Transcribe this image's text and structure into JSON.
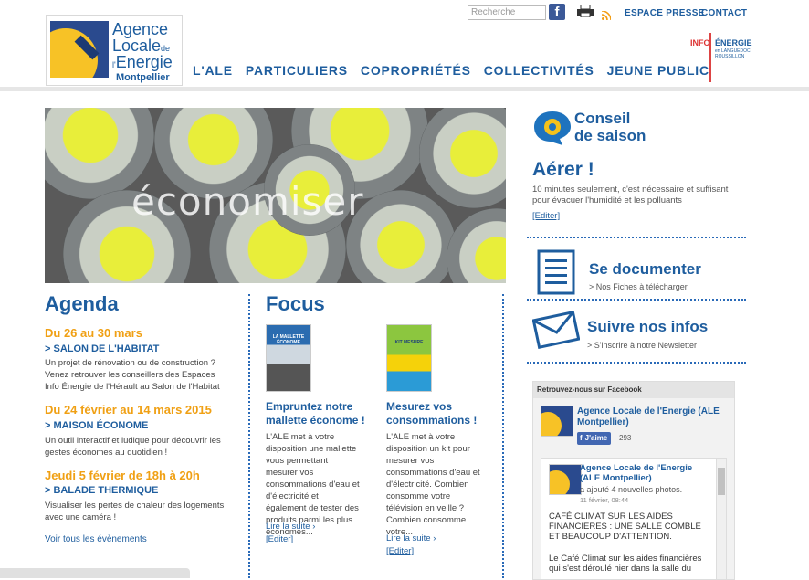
{
  "header": {
    "logo": {
      "line1": "Agence",
      "line2": "Locale",
      "line2_small": "de",
      "line3": "Energie",
      "line3_small": "l'",
      "line4": "Montpellier"
    },
    "search": {
      "placeholder": "Recherche"
    },
    "links": {
      "espace_presse": "ESPACE PRESSE",
      "contact": "CONTACT"
    },
    "partner": {
      "left": "INFO",
      "right": "ÉNERGIE",
      "sub": "en LANGUEDOC ROUSSILLON"
    },
    "nav": [
      "L'ALE",
      "PARTICULIERS",
      "COPROPRIÉTÉS",
      "COLLECTIVITÉS",
      "JEUNE PUBLIC"
    ]
  },
  "hero": {
    "word": "économiser"
  },
  "agenda": {
    "title": "Agenda",
    "events": [
      {
        "date": "Du 26 au 30 mars",
        "name": "> SALON DE L'HABITAT",
        "desc": "Un projet de rénovation ou de construction ? Venez retrouver les conseillers des Espaces Info Énergie de l'Hérault au Salon de l'Habitat"
      },
      {
        "date": "Du 24 février au 14 mars 2015",
        "name": "> MAISON ÉCONOME",
        "desc": "Un outil interactif et ludique pour découvrir les gestes économes au quotidien !"
      },
      {
        "date": "Jeudi 5 février de 18h à 20h",
        "name": "> BALADE THERMIQUE",
        "desc": "Visualiser les pertes de chaleur des logements avec une caméra !"
      }
    ],
    "see_all": "Voir tous les évènements"
  },
  "focus": {
    "title": "Focus",
    "items": [
      {
        "cover_text": "LA MALLETTE ÉCONOME",
        "title": "Empruntez notre mallette économe !",
        "desc": "L'ALE met à votre disposition une mallette vous permettant mesurer vos consommations d'eau et d'électricité et également de tester des produits parmi les plus économes...",
        "more": "Lire la suite  ›",
        "edit": "[Editer]"
      },
      {
        "cover_text": "KIT MESURE",
        "title": "Mesurez vos consommations !",
        "desc": "L'ALE met à votre disposition un kit pour mesurer vos consommations d'eau et d'électricité.   Combien consomme votre télévision en veille ? Combien consomme votre...",
        "more": "Lire la suite  ›",
        "edit": "[Editer]"
      }
    ]
  },
  "sidebar": {
    "conseil": {
      "line1": "Conseil",
      "line2": "de saison"
    },
    "tip": {
      "title": "Aérer !",
      "desc": "10 minutes seulement, c'est nécessaire et suffisant pour évacuer l'humidité et les polluants",
      "edit": "[Editer]"
    },
    "documenter": {
      "title": "Se documenter",
      "sub": "> Nos Fiches à télécharger"
    },
    "infos": {
      "title": "Suivre nos infos",
      "sub": "> S'inscrire à notre Newsletter"
    },
    "facebook": {
      "header": "Retrouvez-nous sur Facebook",
      "page_name": "Agence Locale de l'Energie (ALE Montpellier)",
      "like_label": "J'aime",
      "like_count": "293",
      "post_author": "Agence Locale de l'Energie (ALE Montpellier)",
      "post_action": "a ajouté 4 nouvelles photos.",
      "post_date": "11 février, 08:44",
      "post_text": "CAFÉ CLIMAT SUR LES AIDES FINANCIÈRES : UNE SALLE COMBLE ET BEAUCOUP D'ATTENTION.",
      "post_text2": "Le Café Climat sur les aides financières qui s'est déroulé hier dans la salle du"
    }
  },
  "colors": {
    "brand_blue": "#1e5d9e",
    "accent_orange": "#f0a014",
    "facebook": "#3b5998"
  }
}
